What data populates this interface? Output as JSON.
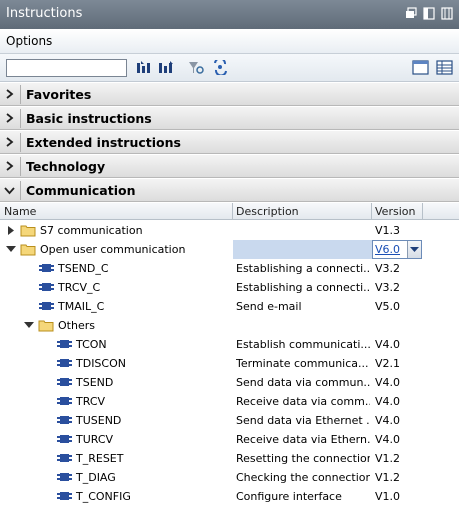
{
  "window": {
    "title": "Instructions"
  },
  "options": {
    "label": "Options"
  },
  "search": {
    "value": "",
    "placeholder": ""
  },
  "sections": {
    "favorites": "Favorites",
    "basic": "Basic instructions",
    "extended": "Extended instructions",
    "technology": "Technology",
    "communication": "Communication"
  },
  "columns": {
    "name": "Name",
    "description": "Description",
    "version": "Version"
  },
  "tree": {
    "s7": {
      "name": "S7 communication",
      "desc": "",
      "ver": "V1.3"
    },
    "ouc": {
      "name": "Open user communication",
      "desc": "",
      "ver": "V6.0"
    },
    "tsend_c": {
      "name": "TSEND_C",
      "desc": "Establishing a connecti...",
      "ver": "V3.2"
    },
    "trcv_c": {
      "name": "TRCV_C",
      "desc": "Establishing a connecti...",
      "ver": "V3.2"
    },
    "tmail_c": {
      "name": "TMAIL_C",
      "desc": "Send e-mail",
      "ver": "V5.0"
    },
    "others": {
      "name": "Others"
    },
    "tcon": {
      "name": "TCON",
      "desc": "Establish communicati...",
      "ver": "V4.0"
    },
    "tdiscon": {
      "name": "TDISCON",
      "desc": "Terminate communica...",
      "ver": "V2.1"
    },
    "tsend": {
      "name": "TSEND",
      "desc": "Send data via commun...",
      "ver": "V4.0"
    },
    "trcv": {
      "name": "TRCV",
      "desc": "Receive data via comm...",
      "ver": "V4.0"
    },
    "tusend": {
      "name": "TUSEND",
      "desc": "Send data via Ethernet ...",
      "ver": "V4.0"
    },
    "turcv": {
      "name": "TURCV",
      "desc": "Receive data via Ethern...",
      "ver": "V4.0"
    },
    "t_reset": {
      "name": "T_RESET",
      "desc": "Resetting the connection",
      "ver": "V1.2"
    },
    "t_diag": {
      "name": "T_DIAG",
      "desc": "Checking the connection",
      "ver": "V1.2"
    },
    "t_config": {
      "name": "T_CONFIG",
      "desc": "Configure interface",
      "ver": "V1.0"
    }
  }
}
